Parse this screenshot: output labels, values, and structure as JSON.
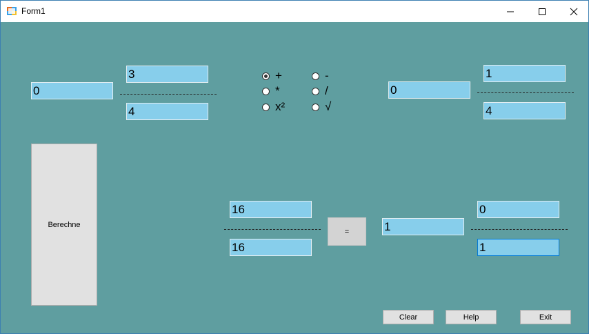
{
  "window": {
    "title": "Form1"
  },
  "fraction1": {
    "whole": "0",
    "numerator": "3",
    "denominator": "4"
  },
  "fraction2": {
    "whole": "0",
    "numerator": "1",
    "denominator": "4"
  },
  "operators": [
    {
      "label": "+",
      "checked": true
    },
    {
      "label": "-",
      "checked": false
    },
    {
      "label": "*",
      "checked": false
    },
    {
      "label": "/",
      "checked": false
    },
    {
      "label": "x²",
      "checked": false
    },
    {
      "label": "√",
      "checked": false
    }
  ],
  "result_input": {
    "numerator": "16",
    "denominator": "16"
  },
  "equals_label": "=",
  "result": {
    "whole": "1",
    "numerator": "0",
    "denominator": "1"
  },
  "buttons": {
    "calculate": "Berechne",
    "clear": "Clear",
    "help": "Help",
    "exit": "Exit"
  }
}
